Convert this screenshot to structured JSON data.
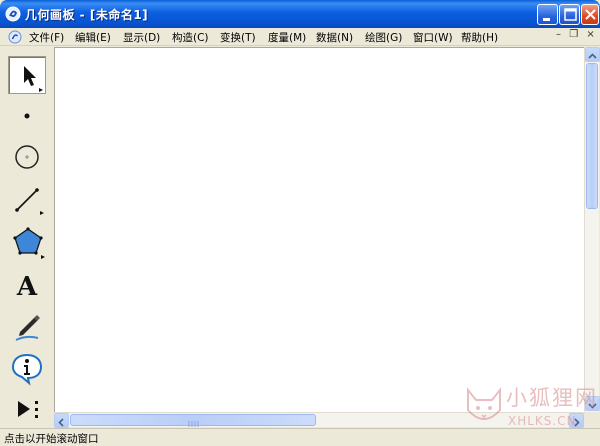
{
  "window": {
    "title": "几何画板 - [未命名1]"
  },
  "menubar": {
    "items": [
      {
        "label": "文件(F)"
      },
      {
        "label": "编辑(E)"
      },
      {
        "label": "显示(D)"
      },
      {
        "label": "构造(C)"
      },
      {
        "label": "变换(T)"
      },
      {
        "label": "度量(M)"
      },
      {
        "label": "数据(N)"
      },
      {
        "label": "绘图(G)"
      },
      {
        "label": "窗口(W)"
      },
      {
        "label": "帮助(H)"
      }
    ]
  },
  "toolbox": {
    "tools": [
      {
        "name": "arrow-select-tool",
        "icon": "arrow-icon",
        "selected": true
      },
      {
        "name": "point-tool",
        "icon": "point-icon"
      },
      {
        "name": "compass-tool",
        "icon": "circle-icon"
      },
      {
        "name": "straightedge-tool",
        "icon": "segment-icon"
      },
      {
        "name": "polygon-tool",
        "icon": "pentagon-icon"
      },
      {
        "name": "text-tool",
        "icon": "text-a-icon",
        "glyph": "A"
      },
      {
        "name": "marker-tool",
        "icon": "pen-icon"
      },
      {
        "name": "information-tool",
        "icon": "info-icon"
      },
      {
        "name": "custom-tool",
        "icon": "play-more-icon"
      }
    ]
  },
  "statusbar": {
    "text": "点击以开始滚动窗口"
  },
  "watermark": {
    "title": "小狐狸网",
    "subtitle": "XHLKS.CN"
  },
  "colors": {
    "titlebar": "#0a5fd8",
    "close_button": "#d94a25",
    "canvas": "#ffffff",
    "chrome": "#ece9d8"
  }
}
